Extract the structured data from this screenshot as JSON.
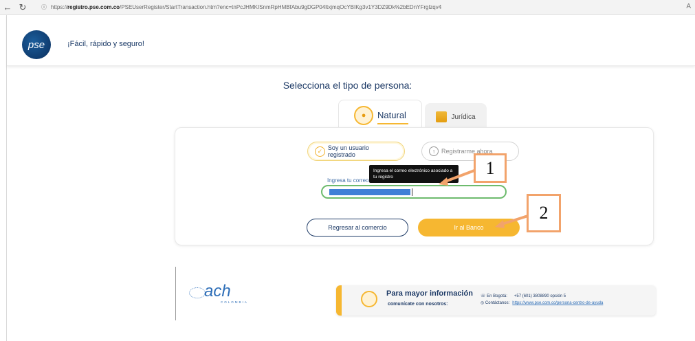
{
  "browser": {
    "url_prefix": "https://",
    "url_domain": "registro.pse.com.co",
    "url_path": "/PSEUserRegister/StartTransaction.htm?enc=tnPcJHMKISnmRpHMBfAbu9gDGP04ltxjmqOcYBIKg3v1Y3DZ9Dk%2bEDnYFrglzqv4",
    "reader_icon": "A"
  },
  "header": {
    "logo_text": "pse",
    "tagline": "¡Fácil, rápido y seguro!"
  },
  "main": {
    "title": "Selecciona el tipo de persona:",
    "tabs": [
      {
        "label": "Natural",
        "active": true
      },
      {
        "label": "Jurídica",
        "active": false
      }
    ],
    "options": {
      "registered": "Soy un usuario registrado",
      "register": "Registrarme ahora"
    },
    "tooltip": "Ingresa el correo electrónico asociado a tu registro",
    "email_label": "Ingresa tu correo",
    "email_value": "",
    "buttons": {
      "return": "Regresar al comercio",
      "bank": "Ir al Banco"
    }
  },
  "annotations": {
    "callout_1": "1",
    "callout_2": "2",
    "arrow_color": "#f2a36b"
  },
  "footer": {
    "ach_text": "ach",
    "ach_sub": "COLOMBIA",
    "info_title": "Para mayor información",
    "info_sub": "comunícate con nosotros:",
    "bogota_label": "En Bogotá:",
    "bogota_value": "+57 (601) 3808890 opción 5",
    "contact_label": "Contáctanos:",
    "contact_link": "https://www.pse.com.co/persona-centro-de-ayuda"
  },
  "colors": {
    "brand_blue": "#1d3a66",
    "accent_yellow": "#f6b731",
    "input_border": "#6dbb6d"
  }
}
